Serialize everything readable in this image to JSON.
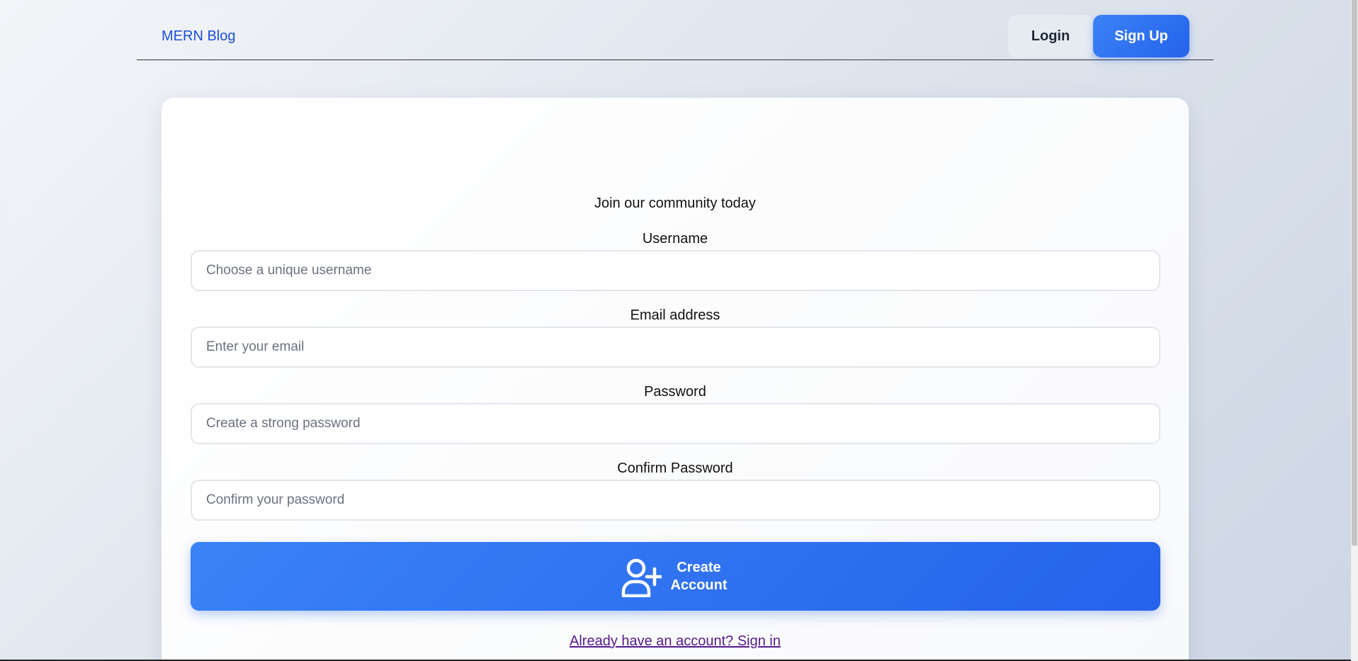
{
  "navbar": {
    "brand": "MERN Blog",
    "login_label": "Login",
    "signup_label": "Sign Up"
  },
  "form": {
    "subtitle": "Join our community today",
    "username": {
      "label": "Username",
      "placeholder": "Choose a unique username"
    },
    "email": {
      "label": "Email address",
      "placeholder": "Enter your email"
    },
    "password": {
      "label": "Password",
      "placeholder": "Create a strong password"
    },
    "confirm_password": {
      "label": "Confirm Password",
      "placeholder": "Confirm your password"
    },
    "submit_label": "Create Account",
    "submit_icon": "user-plus-icon",
    "signin_link": "Already have an account? Sign in"
  },
  "colors": {
    "accent": "#2563eb",
    "accent_light": "#3b82f6",
    "brand_text": "#1d4ed8"
  }
}
